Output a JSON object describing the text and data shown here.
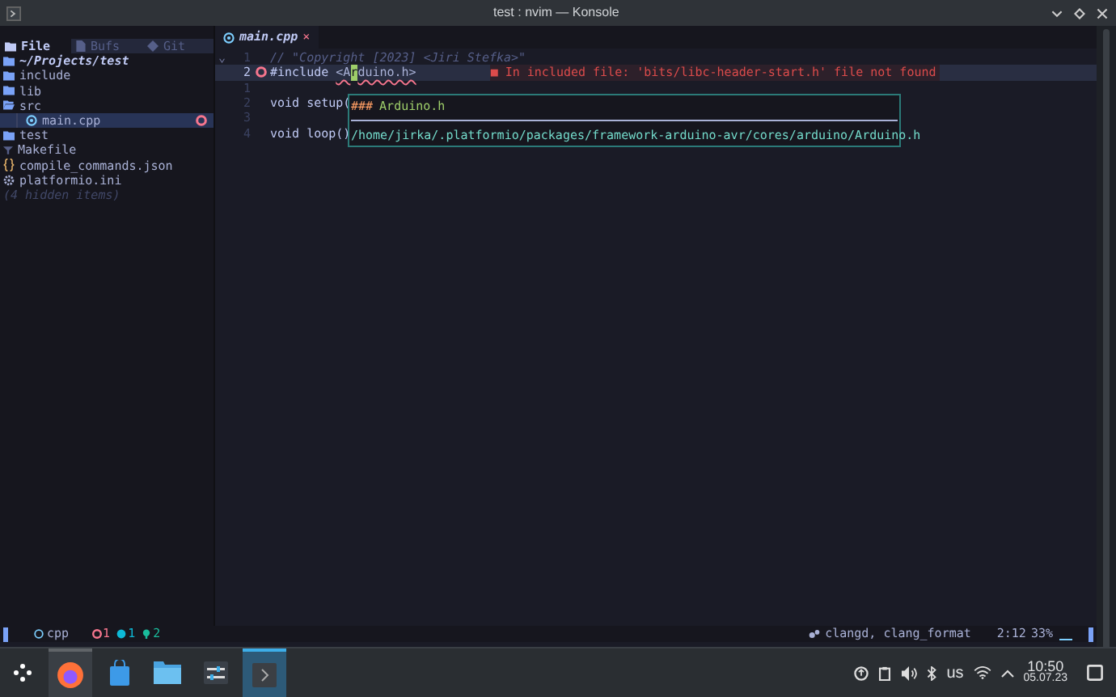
{
  "window": {
    "title": "test : nvim — Konsole"
  },
  "sidebar": {
    "tabs": [
      {
        "label": "File",
        "selected": true
      },
      {
        "label": "Bufs",
        "selected": false
      },
      {
        "label": "Git",
        "selected": false
      }
    ],
    "root": "~/Projects/test",
    "tree": [
      {
        "name": "include",
        "kind": "folder",
        "selected": false,
        "error": false
      },
      {
        "name": "lib",
        "kind": "folder",
        "selected": false,
        "error": false
      },
      {
        "name": "src",
        "kind": "folder-open",
        "selected": false,
        "error": false,
        "children": [
          {
            "name": "main.cpp",
            "kind": "cpp",
            "selected": true,
            "error": true
          }
        ]
      },
      {
        "name": "test",
        "kind": "folder",
        "selected": false,
        "error": false
      },
      {
        "name": "Makefile",
        "kind": "make",
        "selected": false,
        "error": false
      },
      {
        "name": "compile_commands.json",
        "kind": "json",
        "selected": false,
        "error": false
      },
      {
        "name": "platformio.ini",
        "kind": "config",
        "selected": false,
        "error": false
      }
    ],
    "hidden_note": "(4 hidden items)"
  },
  "editor": {
    "tab": {
      "label": "main.cpp",
      "close": "×"
    },
    "lines": [
      {
        "number": "1",
        "current": false,
        "fold": "⌄",
        "error": false,
        "segments": [
          {
            "kind": "comment",
            "text": "// \"Copyright [2023] <Jiri Stefka>\""
          }
        ]
      },
      {
        "number": "2",
        "current": true,
        "error": true,
        "segments": [
          {
            "kind": "keyword",
            "text": "#include "
          },
          {
            "kind": "string",
            "text": "<A"
          },
          {
            "kind": "cursor",
            "text": "r"
          },
          {
            "kind": "string",
            "text": "duino.h>"
          }
        ],
        "diagnostic": "■ In included file: 'bits/libc-header-start.h' file not found"
      },
      {
        "number": "1",
        "current": false,
        "error": false
      },
      {
        "number": "2",
        "current": false,
        "error": false,
        "segments": [
          {
            "kind": "code",
            "text": "void setup("
          }
        ]
      },
      {
        "number": "3",
        "current": false,
        "error": false
      },
      {
        "number": "4",
        "current": false,
        "error": false,
        "segments": [
          {
            "kind": "code",
            "text": "void loop()"
          }
        ]
      }
    ],
    "hover": {
      "marker": "###",
      "heading": "Arduino.h",
      "path": "/home/jirka/.platformio/packages/framework-arduino-avr/cores/arduino/Arduino.h"
    }
  },
  "statusline": {
    "filetype": "cpp",
    "errors": "1",
    "warnings": "1",
    "hints": "2",
    "lsp": "clangd, clang_format",
    "position": "2:12",
    "percent": "33%"
  },
  "taskbar": {
    "apps": [
      {
        "kind": "launcher",
        "selected": false
      },
      {
        "kind": "browser",
        "selected": false
      },
      {
        "kind": "store",
        "selected": false
      },
      {
        "kind": "files",
        "selected": false
      },
      {
        "kind": "mixer",
        "selected": false
      },
      {
        "kind": "terminal",
        "selected": true
      }
    ],
    "keyboard": "us",
    "time": "10:50",
    "date": "05.07.23"
  }
}
